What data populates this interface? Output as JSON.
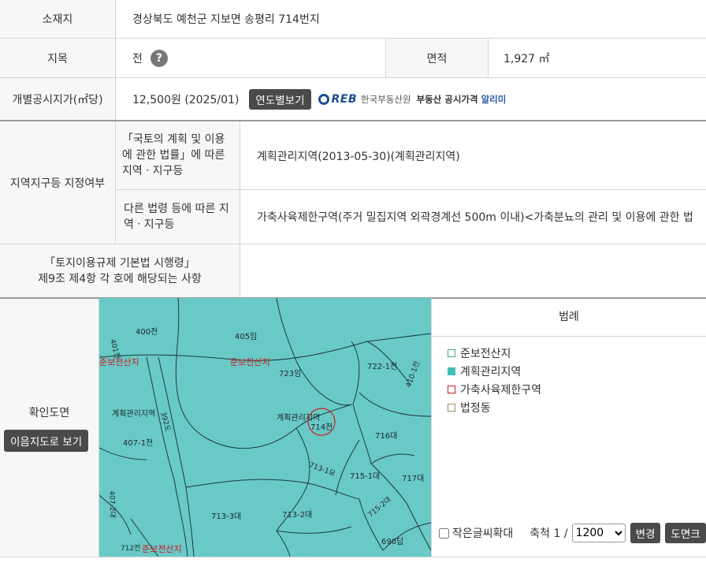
{
  "row1": {
    "label": "소재지",
    "value": "경상북도 예천군 지보면 송평리 714번지"
  },
  "row2": {
    "label": "지목",
    "value": "전",
    "help_icon": "?",
    "area_label": "면적",
    "area_value": "1,927 ㎡"
  },
  "row3": {
    "label": "개별공시지가(㎡당)",
    "value": "12,500원 (2025/01)",
    "button": "연도별보기",
    "reb_logo": "REB",
    "reb_org": "한국부동산원",
    "reb_service_prefix": "부동산 공시가격 ",
    "reb_service_suffix": "알리미"
  },
  "zone": {
    "label": "지역지구등 지정여부",
    "law1_label": "「국토의 계획 및 이용 에 관한 법률」에 따른 지역ㆍ지구등",
    "law1_value": "계획관리지역(2013-05-30)(계획관리지역)",
    "law2_label": "다른 법령 등에 따른 지역ㆍ지구등",
    "law2_value": "가축사육제한구역(주거 밀집지역 외곽경계선 500m 이내)<가축분뇨의 관리 및 이용에 관한 법"
  },
  "rule": {
    "label_line1": "「토지이용규제 기본법 시행령」",
    "label_line2": "제9조 제4항 각 호에 해당되는 사항",
    "value": ""
  },
  "map_section": {
    "label": "확인도면",
    "button": "이음지도로 보기"
  },
  "map_labels": {
    "l400": "400전",
    "l405": "405임",
    "l401": "401전",
    "zone_top": "준보전산지",
    "zone_left": "준보전산지",
    "l723": "723임",
    "l722": "722-1전",
    "l410": "410-1전",
    "plan_left": "계획관리지역",
    "road": "392도",
    "plan_center": "계획관리지역",
    "l714": "714전",
    "l716": "716대",
    "l407": "407-1전",
    "l713_1": "713-1묘",
    "l715_1": "715-1대",
    "l717": "717대",
    "l407_2": "407-2대",
    "l713_3": "713-3대",
    "l713_2": "713-2대",
    "l715_2": "715-2대",
    "l712": "712전",
    "zone_bottom": "준보전산지",
    "l690": "690답"
  },
  "legend": {
    "title": "범례",
    "items": [
      {
        "label": "준보전산지",
        "color": "#3aa88f"
      },
      {
        "label": "계획관리지역",
        "color": "#45bcbc"
      },
      {
        "label": "가축사육제한구역",
        "color": "#cc2020"
      },
      {
        "label": "법정동",
        "color": "#a08c5a"
      }
    ],
    "small_text_label": "작은글씨확대",
    "scale_label": "축척 1 /",
    "scale_value": "1200",
    "change_button": "변경",
    "print_button": "도면크"
  }
}
